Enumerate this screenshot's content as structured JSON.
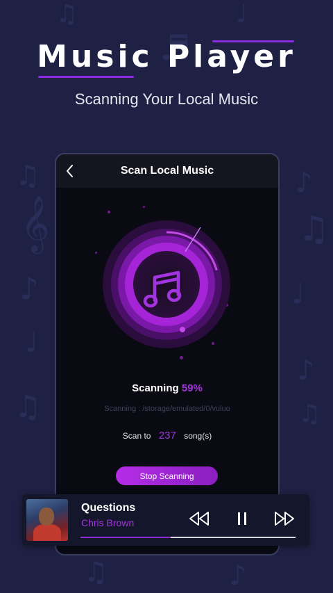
{
  "hero": {
    "title": "Music Player",
    "subtitle": "Scanning Your Local Music"
  },
  "screen": {
    "title": "Scan Local Music",
    "back_icon": "chevron-left-icon",
    "center_icon": "music-note-icon",
    "status_label": "Scanning",
    "status_percent": "59%",
    "scan_progress": 0.59,
    "path_text": "Scanning : /storage/emulated/0/vuluo",
    "count_prefix": "Scan to",
    "count_value": "237",
    "count_suffix": "song(s)",
    "stop_label": "Stop Scanning"
  },
  "player": {
    "song_title": "Questions",
    "artist": "Chris Brown",
    "icons": [
      "rewind-icon",
      "pause-icon",
      "fast-forward-icon"
    ],
    "progress": 0.42
  },
  "colors": {
    "background": "#1f2144",
    "accent": "#a335e0",
    "button": "#b52de8"
  }
}
